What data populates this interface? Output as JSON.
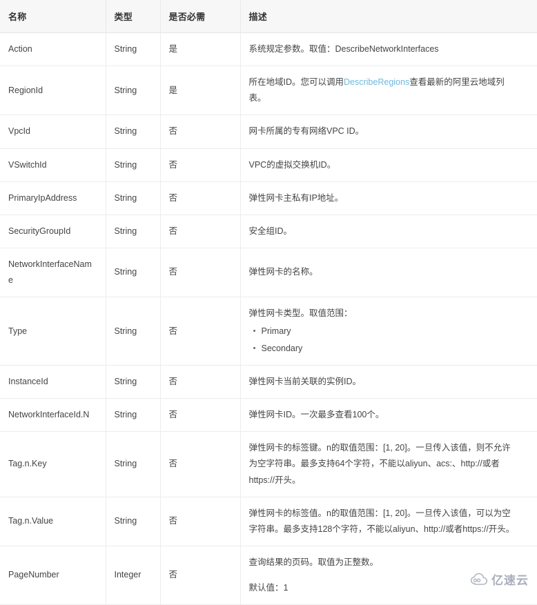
{
  "table": {
    "headers": [
      "名称",
      "类型",
      "是否必需",
      "描述"
    ],
    "rows": [
      {
        "name": "Action",
        "type": "String",
        "required": "是",
        "desc_parts": [
          {
            "kind": "p",
            "text": "系统规定参数。取值：DescribeNetworkInterfaces"
          }
        ]
      },
      {
        "name": "RegionId",
        "type": "String",
        "required": "是",
        "desc_parts": [
          {
            "kind": "p_link",
            "before": "所在地域ID。您可以调用",
            "link": "DescribeRegions",
            "after": "查看最新的阿里云地域列表。"
          }
        ]
      },
      {
        "name": "VpcId",
        "type": "String",
        "required": "否",
        "desc_parts": [
          {
            "kind": "p",
            "text": "网卡所属的专有网络VPC ID。"
          }
        ]
      },
      {
        "name": "VSwitchId",
        "type": "String",
        "required": "否",
        "desc_parts": [
          {
            "kind": "p",
            "text": "VPC的虚拟交换机ID。"
          }
        ]
      },
      {
        "name": "PrimaryIpAddress",
        "type": "String",
        "required": "否",
        "desc_parts": [
          {
            "kind": "p",
            "text": "弹性网卡主私有IP地址。"
          }
        ]
      },
      {
        "name": "SecurityGroupId",
        "type": "String",
        "required": "否",
        "desc_parts": [
          {
            "kind": "p",
            "text": "安全组ID。"
          }
        ]
      },
      {
        "name": "NetworkInterfaceName",
        "type": "String",
        "required": "否",
        "desc_parts": [
          {
            "kind": "p",
            "text": "弹性网卡的名称。"
          }
        ]
      },
      {
        "name": "Type",
        "type": "String",
        "required": "否",
        "desc_parts": [
          {
            "kind": "p",
            "text": "弹性网卡类型。取值范围："
          },
          {
            "kind": "ul",
            "items": [
              "Primary",
              "Secondary"
            ]
          }
        ]
      },
      {
        "name": "InstanceId",
        "type": "String",
        "required": "否",
        "desc_parts": [
          {
            "kind": "p",
            "text": "弹性网卡当前关联的实例ID。"
          }
        ]
      },
      {
        "name": "NetworkInterfaceId.N",
        "type": "String",
        "required": "否",
        "desc_parts": [
          {
            "kind": "p",
            "text": "弹性网卡ID。一次最多查看100个。"
          }
        ]
      },
      {
        "name": "Tag.n.Key",
        "type": "String",
        "required": "否",
        "desc_parts": [
          {
            "kind": "p",
            "text": "弹性网卡的标签键。n的取值范围：[1, 20]。一旦传入该值，则不允许为空字符串。最多支持64个字符，不能以aliyun、acs:、http://或者https://开头。"
          }
        ]
      },
      {
        "name": "Tag.n.Value",
        "type": "String",
        "required": "否",
        "desc_parts": [
          {
            "kind": "p",
            "text": "弹性网卡的标签值。n的取值范围：[1, 20]。一旦传入该值，可以为空字符串。最多支持128个字符，不能以aliyun、http://或者https://开头。"
          }
        ]
      },
      {
        "name": "PageNumber",
        "type": "Integer",
        "required": "否",
        "desc_parts": [
          {
            "kind": "p",
            "text": "查询结果的页码。取值为正整数。"
          },
          {
            "kind": "p",
            "text": "默认值：1"
          }
        ]
      }
    ]
  },
  "watermark": {
    "text": "亿速云",
    "icon": "cloud-icon"
  },
  "colors": {
    "link": "#6cb8dd",
    "header_bg": "#f7f7f7",
    "border": "#ececec",
    "text": "#444444",
    "watermark": "#8a8fa3"
  }
}
